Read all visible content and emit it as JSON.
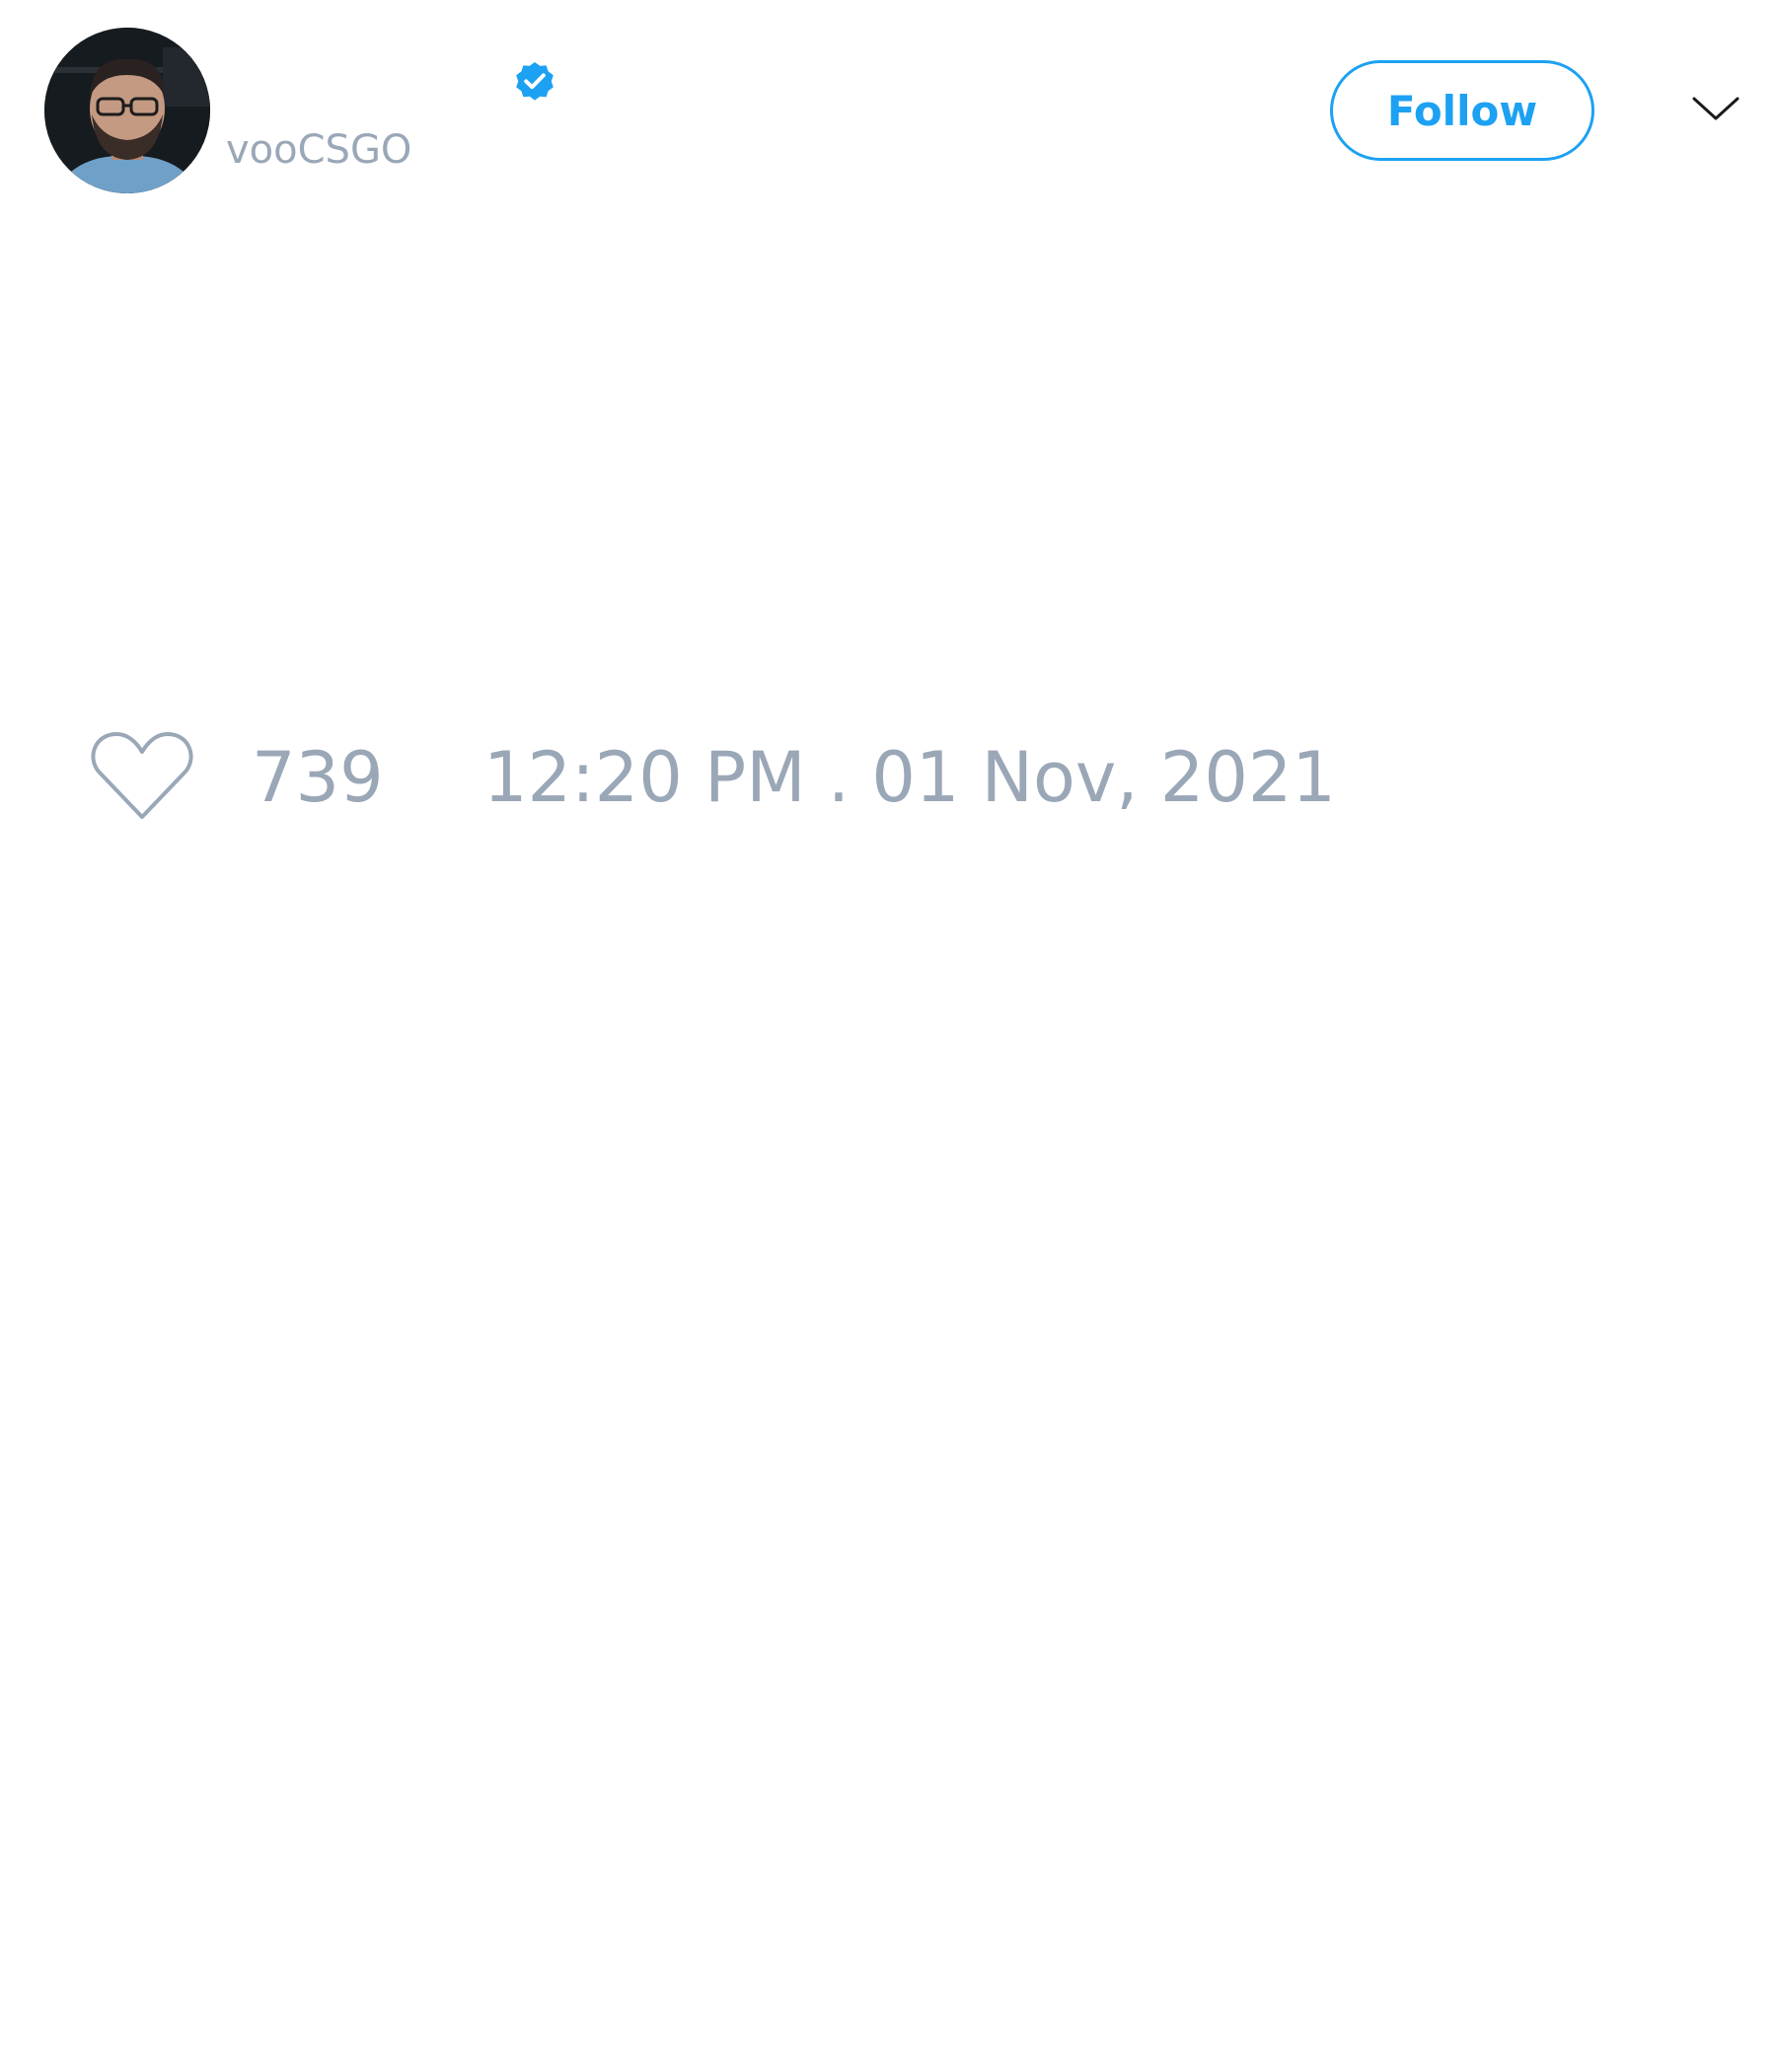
{
  "tweet": {
    "author": {
      "handle": "vooCSGO",
      "verified": true,
      "avatar_icon": "person-avatar"
    },
    "follow_label": "Follow",
    "menu_icon": "chevron-down-icon",
    "likes": {
      "icon": "heart-icon",
      "count": "739"
    },
    "timestamp": "12:20 PM . 01 Nov, 2021"
  },
  "colors": {
    "accent": "#1da1f2",
    "muted_text": "#9aa7b7",
    "background": "#ffffff"
  }
}
